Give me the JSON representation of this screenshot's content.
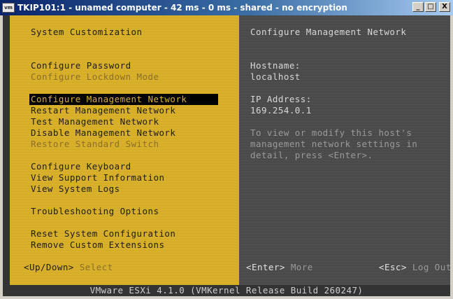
{
  "window": {
    "icon_label": "vm",
    "title": "TKIP101:1 - unamed computer - 42 ms - 0 ms - shared - no encryption",
    "minimize_glyph": "_",
    "maximize_glyph": "□",
    "close_glyph": "X"
  },
  "left_panel": {
    "header": "System Customization",
    "items": [
      {
        "label": "Configure Password",
        "enabled": true
      },
      {
        "label": "Configure Lockdown Mode",
        "enabled": false
      },
      {
        "label": "Configure Management Network",
        "enabled": true,
        "selected": true
      },
      {
        "label": "Restart Management Network",
        "enabled": true
      },
      {
        "label": "Test Management Network",
        "enabled": true
      },
      {
        "label": "Disable Management Network",
        "enabled": true
      },
      {
        "label": "Restore Standard Switch",
        "enabled": false
      },
      {
        "label": "Configure Keyboard",
        "enabled": true
      },
      {
        "label": "View Support Information",
        "enabled": true
      },
      {
        "label": "View System Logs",
        "enabled": true
      },
      {
        "label": "Troubleshooting Options",
        "enabled": true
      },
      {
        "label": "Reset System Configuration",
        "enabled": true
      },
      {
        "label": "Remove Custom Extensions",
        "enabled": true
      }
    ],
    "hint_key": "<Up/Down>",
    "hint_action": "Select"
  },
  "right_panel": {
    "header": "Configure Management Network",
    "hostname_label": "Hostname:",
    "hostname_value": "localhost",
    "ip_label": "IP Address:",
    "ip_value": "169.254.0.1",
    "description": [
      "To view or modify this host's",
      "management network settings in",
      "detail, press <Enter>."
    ],
    "enter_key": "<Enter>",
    "enter_action": "More",
    "esc_key": "<Esc>",
    "esc_action": "Log Out"
  },
  "footer": {
    "text": "VMware ESXi 4.1.0 (VMKernel Release Build 260247)"
  },
  "colors": {
    "left_panel_bg": "#d9b02a",
    "right_panel_bg": "#4a4a4a",
    "selection_bg": "#000000",
    "titlebar_start": "#0a246a"
  }
}
